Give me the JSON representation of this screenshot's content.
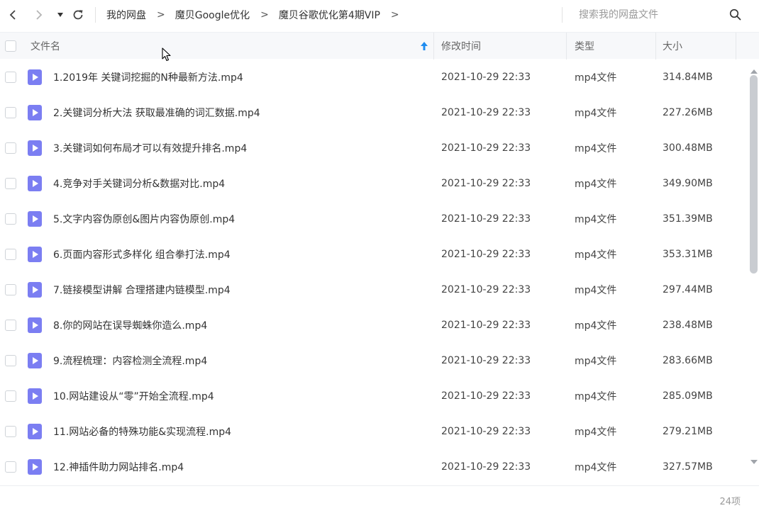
{
  "breadcrumb": [
    {
      "label": "我的网盘"
    },
    {
      "label": "魔贝Google优化"
    },
    {
      "label": "魔贝谷歌优化第4期VIP"
    }
  ],
  "breadcrumb_separator": ">",
  "search": {
    "placeholder": "搜索我的网盘文件"
  },
  "table": {
    "headers": {
      "name": "文件名",
      "modified": "修改时间",
      "type": "类型",
      "size": "大小"
    },
    "sort": {
      "column": "name",
      "direction": "ascending"
    },
    "rows": [
      {
        "name": "1.2019年 关键词挖掘的N种最新方法.mp4",
        "modified": "2021-10-29 22:33",
        "type": "mp4文件",
        "size": "314.84MB"
      },
      {
        "name": "2.关键词分析大法 获取最准确的词汇数据.mp4",
        "modified": "2021-10-29 22:33",
        "type": "mp4文件",
        "size": "227.26MB"
      },
      {
        "name": "3.关键词如何布局才可以有效提升排名.mp4",
        "modified": "2021-10-29 22:33",
        "type": "mp4文件",
        "size": "300.48MB"
      },
      {
        "name": "4.竞争对手关键词分析&数据对比.mp4",
        "modified": "2021-10-29 22:33",
        "type": "mp4文件",
        "size": "349.90MB"
      },
      {
        "name": "5.文字内容伪原创&图片内容伪原创.mp4",
        "modified": "2021-10-29 22:33",
        "type": "mp4文件",
        "size": "351.39MB"
      },
      {
        "name": "6.页面内容形式多样化 组合拳打法.mp4",
        "modified": "2021-10-29 22:33",
        "type": "mp4文件",
        "size": "353.31MB"
      },
      {
        "name": "7.链接模型讲解 合理搭建内链模型.mp4",
        "modified": "2021-10-29 22:33",
        "type": "mp4文件",
        "size": "297.44MB"
      },
      {
        "name": "8.你的网站在误导蜘蛛你造么.mp4",
        "modified": "2021-10-29 22:33",
        "type": "mp4文件",
        "size": "238.48MB"
      },
      {
        "name": "9.流程梳理：内容检测全流程.mp4",
        "modified": "2021-10-29 22:33",
        "type": "mp4文件",
        "size": "283.66MB"
      },
      {
        "name": "10.网站建设从“零”开始全流程.mp4",
        "modified": "2021-10-29 22:33",
        "type": "mp4文件",
        "size": "285.09MB"
      },
      {
        "name": "11.网站必备的特殊功能&实现流程.mp4",
        "modified": "2021-10-29 22:33",
        "type": "mp4文件",
        "size": "279.21MB"
      },
      {
        "name": "12.神插件助力网站排名.mp4",
        "modified": "2021-10-29 22:33",
        "type": "mp4文件",
        "size": "327.57MB"
      }
    ]
  },
  "footer": {
    "count": "24项"
  },
  "icons": {
    "back": "back-arrow-icon",
    "forward": "forward-arrow-icon",
    "history": "history-dropdown-icon",
    "refresh": "refresh-icon",
    "search": "search-icon",
    "file": "video-file-icon",
    "sort": "sort-ascending-icon"
  },
  "colors": {
    "file_icon": "#7b7ef2",
    "sort_arrow": "#1f8cf0",
    "header_bg": "#f7f8fa",
    "scroll_thumb": "#c9ccd1"
  }
}
